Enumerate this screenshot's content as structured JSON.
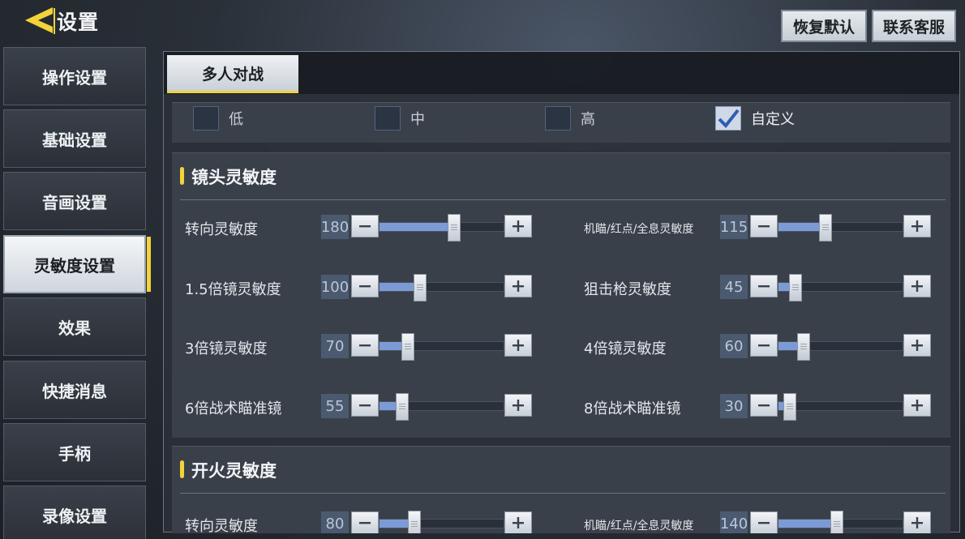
{
  "header": {
    "title": "设置",
    "reset_label": "恢复默认",
    "support_label": "联系客服"
  },
  "sidebar": {
    "items": [
      {
        "label": "操作设置",
        "active": false
      },
      {
        "label": "基础设置",
        "active": false
      },
      {
        "label": "音画设置",
        "active": false
      },
      {
        "label": "灵敏度设置",
        "active": true
      },
      {
        "label": "效果",
        "active": false
      },
      {
        "label": "快捷消息",
        "active": false
      },
      {
        "label": "手柄",
        "active": false
      },
      {
        "label": "录像设置",
        "active": false
      }
    ]
  },
  "tabs": [
    {
      "label": "多人对战",
      "active": true
    }
  ],
  "presets": [
    {
      "label": "低",
      "checked": false
    },
    {
      "label": "中",
      "checked": false
    },
    {
      "label": "高",
      "checked": false
    },
    {
      "label": "自定义",
      "checked": true
    }
  ],
  "camera_section": {
    "title": "镜头灵敏度",
    "left": [
      {
        "label": "转向灵敏度",
        "value": "180",
        "fraction": 0.6
      },
      {
        "label": "1.5倍镜灵敏度",
        "value": "100",
        "fraction": 0.33
      },
      {
        "label": "3倍镜灵敏度",
        "value": "70",
        "fraction": 0.23
      },
      {
        "label": "6倍战术瞄准镜",
        "value": "55",
        "fraction": 0.18
      }
    ],
    "right": [
      {
        "label": "机瞄/红点/全息灵敏度",
        "value": "115",
        "fraction": 0.38
      },
      {
        "label": "狙击枪灵敏度",
        "value": "45",
        "fraction": 0.14
      },
      {
        "label": "4倍镜灵敏度",
        "value": "60",
        "fraction": 0.2
      },
      {
        "label": "8倍战术瞄准镜",
        "value": "30",
        "fraction": 0.09
      }
    ]
  },
  "fire_section": {
    "title": "开火灵敏度",
    "left": [
      {
        "label": "转向灵敏度",
        "value": "80",
        "fraction": 0.28
      }
    ],
    "right": [
      {
        "label": "机瞄/红点/全息灵敏度",
        "value": "140",
        "fraction": 0.47
      }
    ]
  },
  "colors": {
    "accent": "#f3d23a",
    "slider_fill": "#7c9bd6"
  },
  "icons": {
    "back": "back-arrow-icon",
    "minus": "minus-icon",
    "plus": "plus-icon",
    "check": "check-icon"
  }
}
